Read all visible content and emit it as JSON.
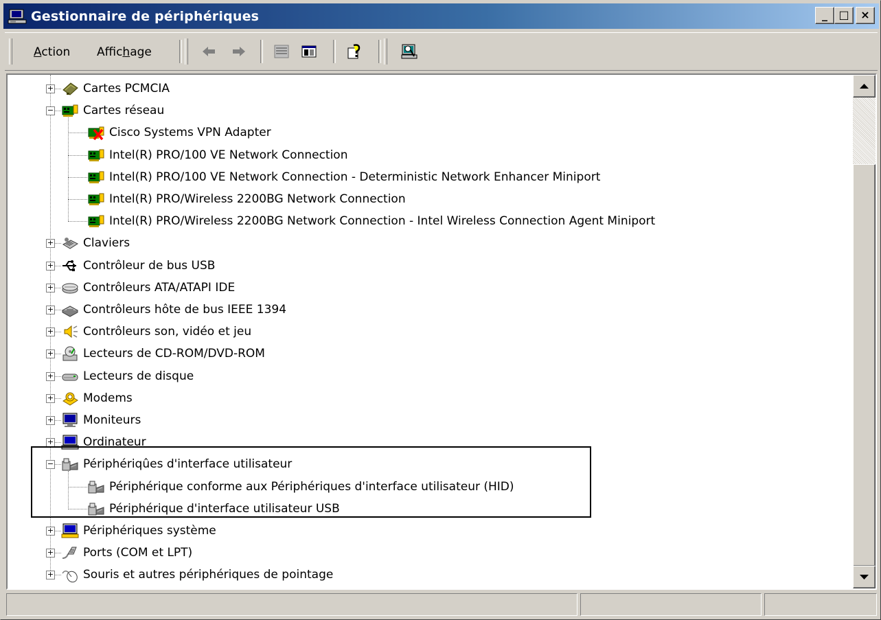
{
  "window": {
    "title": "Gestionnaire de périphériques",
    "minimize_label": "_",
    "maximize_label": "□",
    "close_label": "×"
  },
  "menu": {
    "action": {
      "before": "",
      "mnemonic": "A",
      "after": "ction"
    },
    "view": {
      "before": "Affic",
      "mnemonic": "h",
      "after": "age"
    }
  },
  "toolbar": {
    "buttons": [
      "back-arrow-icon",
      "forward-arrow-icon",
      "properties-panel-icon",
      "console-tree-icon",
      "help-icon",
      "scan-hardware-icon"
    ]
  },
  "tree": {
    "rows": [
      {
        "label": "Cartes PCMCIA",
        "icon": "pcmcia-card-icon",
        "expanded": false
      },
      {
        "label": "Cartes réseau",
        "icon": "network-card-icon",
        "expanded": true
      },
      {
        "label": "Cisco Systems VPN Adapter",
        "icon": "network-card-disabled-icon",
        "child": true
      },
      {
        "label": "Intel(R) PRO/100 VE Network Connection",
        "icon": "network-card-icon",
        "child": true
      },
      {
        "label": "Intel(R) PRO/100 VE Network Connection - Deterministic Network Enhancer Miniport",
        "icon": "network-card-icon",
        "child": true
      },
      {
        "label": "Intel(R) PRO/Wireless 2200BG Network Connection",
        "icon": "network-card-icon",
        "child": true
      },
      {
        "label": "Intel(R) PRO/Wireless 2200BG Network Connection - Intel Wireless Connection Agent Miniport",
        "icon": "network-card-icon",
        "child": true
      },
      {
        "label": "Claviers",
        "icon": "keyboard-icon",
        "expanded": false
      },
      {
        "label": "Contrôleur de bus USB",
        "icon": "usb-icon",
        "expanded": false
      },
      {
        "label": "Contrôleurs ATA/ATAPI IDE",
        "icon": "ide-controller-icon",
        "expanded": false
      },
      {
        "label": "Contrôleurs hôte de bus IEEE 1394",
        "icon": "ieee1394-icon",
        "expanded": false
      },
      {
        "label": "Contrôleurs son, vidéo et jeu",
        "icon": "speaker-icon",
        "expanded": false
      },
      {
        "label": "Lecteurs de CD-ROM/DVD-ROM",
        "icon": "cdrom-icon",
        "expanded": false
      },
      {
        "label": "Lecteurs de disque",
        "icon": "disk-drive-icon",
        "expanded": false
      },
      {
        "label": "Modems",
        "icon": "modem-icon",
        "expanded": false
      },
      {
        "label": "Moniteurs",
        "icon": "monitor-icon",
        "expanded": false
      },
      {
        "label": "Ordinateur",
        "icon": "computer-icon",
        "expanded": false
      },
      {
        "label": "Périphériqûes d'interface utilisateur",
        "icon": "hid-icon",
        "expanded": true
      },
      {
        "label": "Périphérique conforme aux Périphériques d'interface utilisateur (HID)",
        "icon": "hid-icon",
        "child": true
      },
      {
        "label": "Périphérique d'interface utilisateur USB",
        "icon": "hid-icon",
        "child": true
      },
      {
        "label": "Périphériques système",
        "icon": "system-device-icon",
        "expanded": false
      },
      {
        "label": "Ports (COM et LPT)",
        "icon": "port-icon",
        "expanded": false
      },
      {
        "label": "Souris et autres périphériques de pointage",
        "icon": "mouse-icon",
        "expanded": false
      }
    ]
  },
  "colors": {
    "title_gradient_start": "#0a246a",
    "title_gradient_end": "#a6caf0",
    "chrome": "#d4d0c8"
  }
}
